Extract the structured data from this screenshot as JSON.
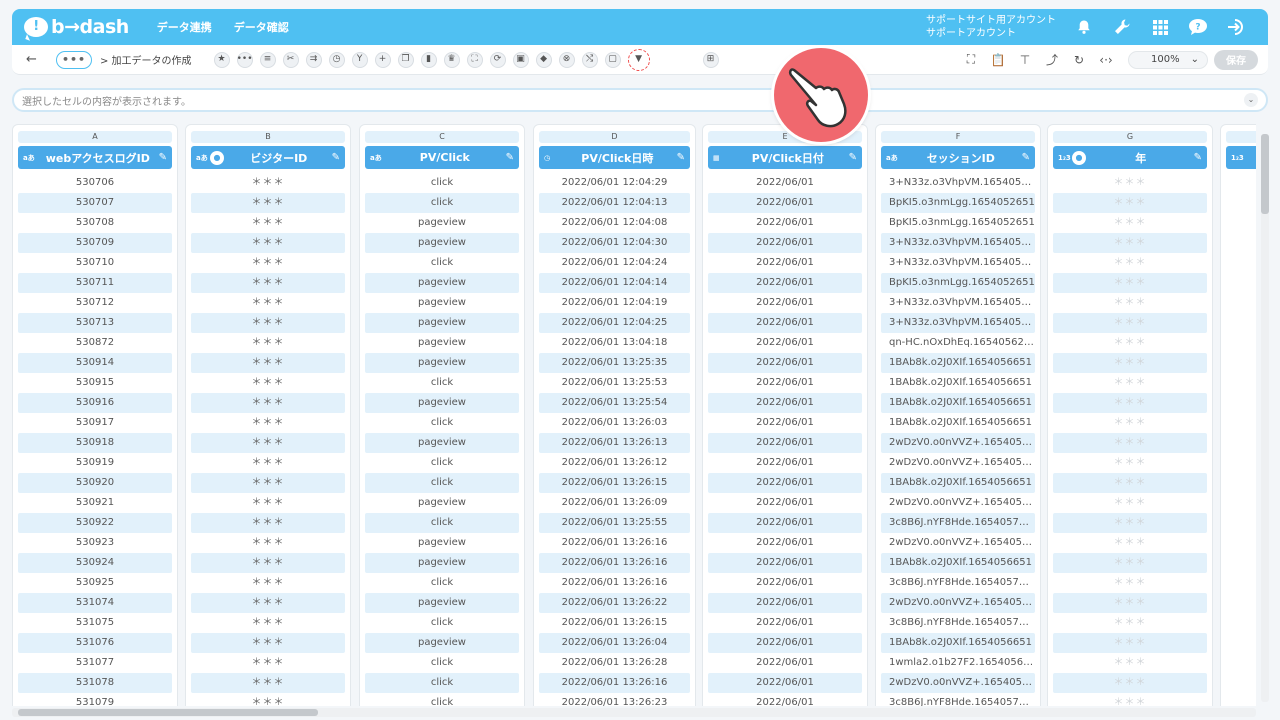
{
  "app": {
    "logo_text": "b→dash",
    "nav": [
      "データ連携",
      "データ確認"
    ],
    "account_line1": "サポートサイト用アカウント",
    "account_line2": "サポートアカウント",
    "brand_color": "#4fc0f2",
    "header_icons": [
      "bell-icon",
      "wrench-icon",
      "apps-grid-icon",
      "help-chat-icon",
      "logout-icon"
    ]
  },
  "toolbar": {
    "back": "←",
    "more": "•••",
    "breadcrumb": "> 加工データの作成",
    "tools": [
      {
        "name": "favorite-icon",
        "glyph": "★"
      },
      {
        "name": "more-icon",
        "glyph": "•••"
      },
      {
        "name": "list-icon",
        "glyph": "≡"
      },
      {
        "name": "tools-icon",
        "glyph": "✂"
      },
      {
        "name": "merge-icon",
        "glyph": "⇉"
      },
      {
        "name": "timer-icon",
        "glyph": "◷"
      },
      {
        "name": "branch-icon",
        "glyph": "Y"
      },
      {
        "name": "add-icon",
        "glyph": "+"
      },
      {
        "name": "copy-icon",
        "glyph": "❐"
      },
      {
        "name": "delete-icon",
        "glyph": "▮"
      },
      {
        "name": "crown-icon",
        "glyph": "♛"
      },
      {
        "name": "expand-icon",
        "glyph": "⛶"
      },
      {
        "name": "sync-icon",
        "glyph": "⟳"
      },
      {
        "name": "lock-icon",
        "glyph": "▣"
      },
      {
        "name": "package-icon",
        "glyph": "◆"
      },
      {
        "name": "cancel-icon",
        "glyph": "⊗"
      },
      {
        "name": "shuffle-icon",
        "glyph": "⤭"
      },
      {
        "name": "frame-icon",
        "glyph": "▢"
      },
      {
        "name": "filter-icon",
        "glyph": "▼"
      },
      {
        "name": "hidden-icon",
        "glyph": " "
      },
      {
        "name": "hidden2-icon",
        "glyph": " "
      },
      {
        "name": "ruler-icon",
        "glyph": "⊞"
      }
    ],
    "right_tools": [
      {
        "name": "fullscreen-icon",
        "glyph": "⛶"
      },
      {
        "name": "clipboard-icon",
        "glyph": "📋"
      },
      {
        "name": "hierarchy-icon",
        "glyph": "⊤"
      },
      {
        "name": "share-icon",
        "glyph": "⤴"
      },
      {
        "name": "refresh-icon",
        "glyph": "↻"
      },
      {
        "name": "code-icon",
        "glyph": "‹·›"
      }
    ],
    "zoom": "100%",
    "zoom_chevron": "⌄",
    "save_label": "保存"
  },
  "cellbar": {
    "placeholder": "選択したセルの内容が表示されます。",
    "chevron": "⌄"
  },
  "columns": [
    {
      "letter": "A",
      "type": "aあ",
      "name": "webアクセスログID",
      "people": false,
      "edit": "✎",
      "cells": [
        "530706",
        "530707",
        "530708",
        "530709",
        "530710",
        "530711",
        "530712",
        "530713",
        "530872",
        "530914",
        "530915",
        "530916",
        "530917",
        "530918",
        "530919",
        "530920",
        "530921",
        "530922",
        "530923",
        "530924",
        "530925",
        "531074",
        "531075",
        "531076",
        "531077",
        "531078",
        "531079"
      ]
    },
    {
      "letter": "B",
      "type": "aあ",
      "name": "ビジターID",
      "people": true,
      "edit": "✎",
      "mask": true,
      "cells": [
        "＊＊＊",
        "＊＊＊",
        "＊＊＊",
        "＊＊＊",
        "＊＊＊",
        "＊＊＊",
        "＊＊＊",
        "＊＊＊",
        "＊＊＊",
        "＊＊＊",
        "＊＊＊",
        "＊＊＊",
        "＊＊＊",
        "＊＊＊",
        "＊＊＊",
        "＊＊＊",
        "＊＊＊",
        "＊＊＊",
        "＊＊＊",
        "＊＊＊",
        "＊＊＊",
        "＊＊＊",
        "＊＊＊",
        "＊＊＊",
        "＊＊＊",
        "＊＊＊",
        "＊＊＊"
      ]
    },
    {
      "letter": "C",
      "type": "aあ",
      "name": "PV/Click",
      "people": false,
      "edit": "✎",
      "cells": [
        "click",
        "click",
        "pageview",
        "pageview",
        "click",
        "pageview",
        "pageview",
        "pageview",
        "pageview",
        "pageview",
        "click",
        "pageview",
        "click",
        "pageview",
        "click",
        "click",
        "pageview",
        "click",
        "pageview",
        "pageview",
        "click",
        "pageview",
        "click",
        "pageview",
        "click",
        "click",
        "click"
      ]
    },
    {
      "letter": "D",
      "type": "◷",
      "name": "PV/Click日時",
      "people": false,
      "edit": "✎",
      "cells": [
        "2022/06/01 12:04:29",
        "2022/06/01 12:04:13",
        "2022/06/01 12:04:08",
        "2022/06/01 12:04:30",
        "2022/06/01 12:04:24",
        "2022/06/01 12:04:14",
        "2022/06/01 12:04:19",
        "2022/06/01 12:04:25",
        "2022/06/01 13:04:18",
        "2022/06/01 13:25:35",
        "2022/06/01 13:25:53",
        "2022/06/01 13:25:54",
        "2022/06/01 13:26:03",
        "2022/06/01 13:26:13",
        "2022/06/01 13:26:12",
        "2022/06/01 13:26:15",
        "2022/06/01 13:26:09",
        "2022/06/01 13:25:55",
        "2022/06/01 13:26:16",
        "2022/06/01 13:26:16",
        "2022/06/01 13:26:16",
        "2022/06/01 13:26:22",
        "2022/06/01 13:26:15",
        "2022/06/01 13:26:04",
        "2022/06/01 13:26:28",
        "2022/06/01 13:26:16",
        "2022/06/01 13:26:23"
      ]
    },
    {
      "letter": "E",
      "type": "▦",
      "name": "PV/Click日付",
      "people": false,
      "edit": "✎",
      "cells": [
        "2022/06/01",
        "2022/06/01",
        "2022/06/01",
        "2022/06/01",
        "2022/06/01",
        "2022/06/01",
        "2022/06/01",
        "2022/06/01",
        "2022/06/01",
        "2022/06/01",
        "2022/06/01",
        "2022/06/01",
        "2022/06/01",
        "2022/06/01",
        "2022/06/01",
        "2022/06/01",
        "2022/06/01",
        "2022/06/01",
        "2022/06/01",
        "2022/06/01",
        "2022/06/01",
        "2022/06/01",
        "2022/06/01",
        "2022/06/01",
        "2022/06/01",
        "2022/06/01",
        "2022/06/01"
      ]
    },
    {
      "letter": "F",
      "type": "aあ",
      "name": "セッションID",
      "people": false,
      "edit": "✎",
      "left": true,
      "cells": [
        "3+N33z.o3VhpVM.1654052675",
        "BpKI5.o3nmLgg.1654052651",
        "BpKI5.o3nmLgg.1654052651",
        "3+N33z.o3VhpVM.1654052675",
        "3+N33z.o3VhpVM.1654052675",
        "BpKI5.o3nmLgg.1654052651",
        "3+N33z.o3VhpVM.1654052675",
        "3+N33z.o3VhpVM.1654052675",
        "qn-HC.nOxDhEq.1654056256",
        "1BAb8k.o2J0XIf.1654056651",
        "1BAb8k.o2J0XIf.1654056651",
        "1BAb8k.o2J0XIf.1654056651",
        "1BAb8k.o2J0XIf.1654056651",
        "2wDzV0.o0nVVZ+.1654057581",
        "2wDzV0.o0nVVZ+.1654057581",
        "1BAb8k.o2J0XIf.1654056651",
        "2wDzV0.o0nVVZ+.1654057581",
        "3c8B6J.nYF8Hde.1654057373",
        "2wDzV0.o0nVVZ+.1654057581",
        "1BAb8k.o2J0XIf.1654056651",
        "3c8B6J.nYF8Hde.1654057373",
        "2wDzV0.o0nVVZ+.1654057581",
        "3c8B6J.nYF8Hde.1654057373",
        "1BAb8k.o2J0XIf.1654056651",
        "1wmla2.o1b27F2.1654056581",
        "2wDzV0.o0nVVZ+.1654057581",
        "3c8B6J.nYF8Hde.1654057373"
      ]
    },
    {
      "letter": "G",
      "type": "1₂3",
      "name": "年",
      "people": true,
      "edit": "✎",
      "light": true,
      "cells": [
        "＊＊＊",
        "＊＊＊",
        "＊＊＊",
        "＊＊＊",
        "＊＊＊",
        "＊＊＊",
        "＊＊＊",
        "＊＊＊",
        "＊＊＊",
        "＊＊＊",
        "＊＊＊",
        "＊＊＊",
        "＊＊＊",
        "＊＊＊",
        "＊＊＊",
        "＊＊＊",
        "＊＊＊",
        "＊＊＊",
        "＊＊＊",
        "＊＊＊",
        "＊＊＊",
        "＊＊＊",
        "＊＊＊",
        "＊＊＊",
        "＊＊＊",
        "＊＊＊",
        "＊＊＊"
      ]
    },
    {
      "letter": "",
      "type": "1₂3",
      "name": "",
      "people": false,
      "edit": "",
      "cells": []
    }
  ]
}
